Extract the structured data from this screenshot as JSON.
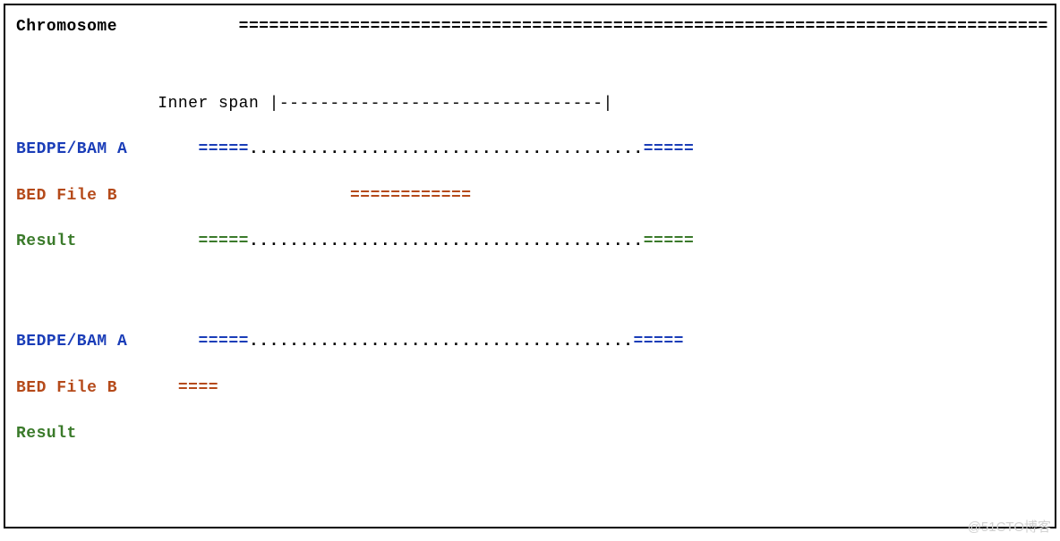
{
  "labels": {
    "chromosome": "Chromosome",
    "inner_span": "Inner span",
    "bedpe_a": "BEDPE/BAM A",
    "bed_b": "BED File B",
    "result": "Result"
  },
  "section1": {
    "chromosome_bar": "================================================================================",
    "inner_span_bar": "|--------------------------------|",
    "a_left": "=====",
    "a_dots": ".......................................",
    "a_right": "=====",
    "b_bar": "============",
    "result_left": "=====",
    "result_dots": ".......................................",
    "result_right": "====="
  },
  "section2": {
    "a_left": "=====",
    "a_dots": "......................................",
    "a_right": "=====",
    "b_bar": "====",
    "result_content": ""
  },
  "spacing": {
    "label_col": "            ",
    "inner_span_indent": "              ",
    "content_indent": "       ",
    "b_indent": "                       ",
    "b2_indent": "      "
  },
  "watermark": "@51CTO博客"
}
